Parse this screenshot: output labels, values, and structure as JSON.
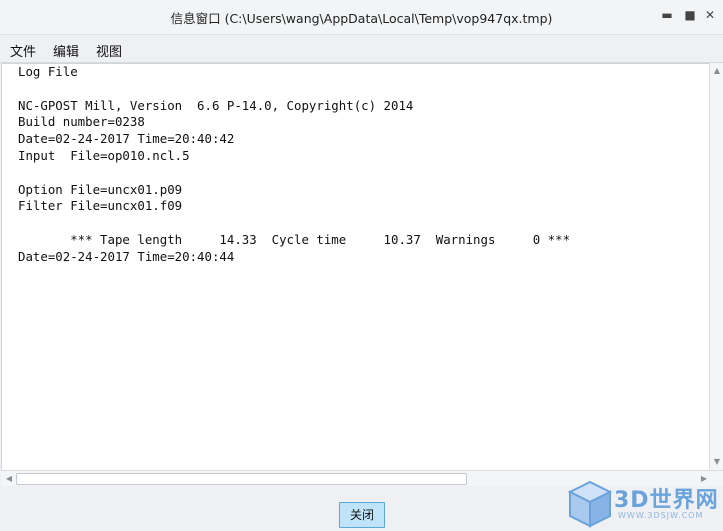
{
  "window": {
    "title": "信息窗口 (C:\\Users\\wang\\AppData\\Local\\Temp\\vop947qx.tmp)",
    "minimize_glyph": "▬",
    "maximize_glyph": "■",
    "close_glyph": "✕"
  },
  "menu": {
    "file": "文件",
    "edit": "编辑",
    "view": "视图"
  },
  "log": {
    "lines": [
      "Log File",
      "",
      "NC-GPOST Mill, Version  6.6 P-14.0, Copyright(c) 2014",
      "Build number=0238",
      "Date=02-24-2017 Time=20:40:42",
      "Input  File=op010.ncl.5",
      "",
      "Option File=uncx01.p09",
      "Filter File=uncx01.f09",
      "",
      "       *** Tape length     14.33  Cycle time     10.37  Warnings     0 ***",
      "Date=02-24-2017 Time=20:40:44"
    ]
  },
  "scroll": {
    "up_glyph": "▲",
    "down_glyph": "▼",
    "left_glyph": "◀",
    "right_glyph": "▶"
  },
  "buttons": {
    "close": "关闭"
  },
  "watermark": {
    "brand": "3D世界网",
    "url": "WWW.3DSJW.COM"
  },
  "colors": {
    "accent_button": "#bfe3f8",
    "accent_border": "#5aa8d8",
    "logo_blue": "#6aa3dc"
  }
}
